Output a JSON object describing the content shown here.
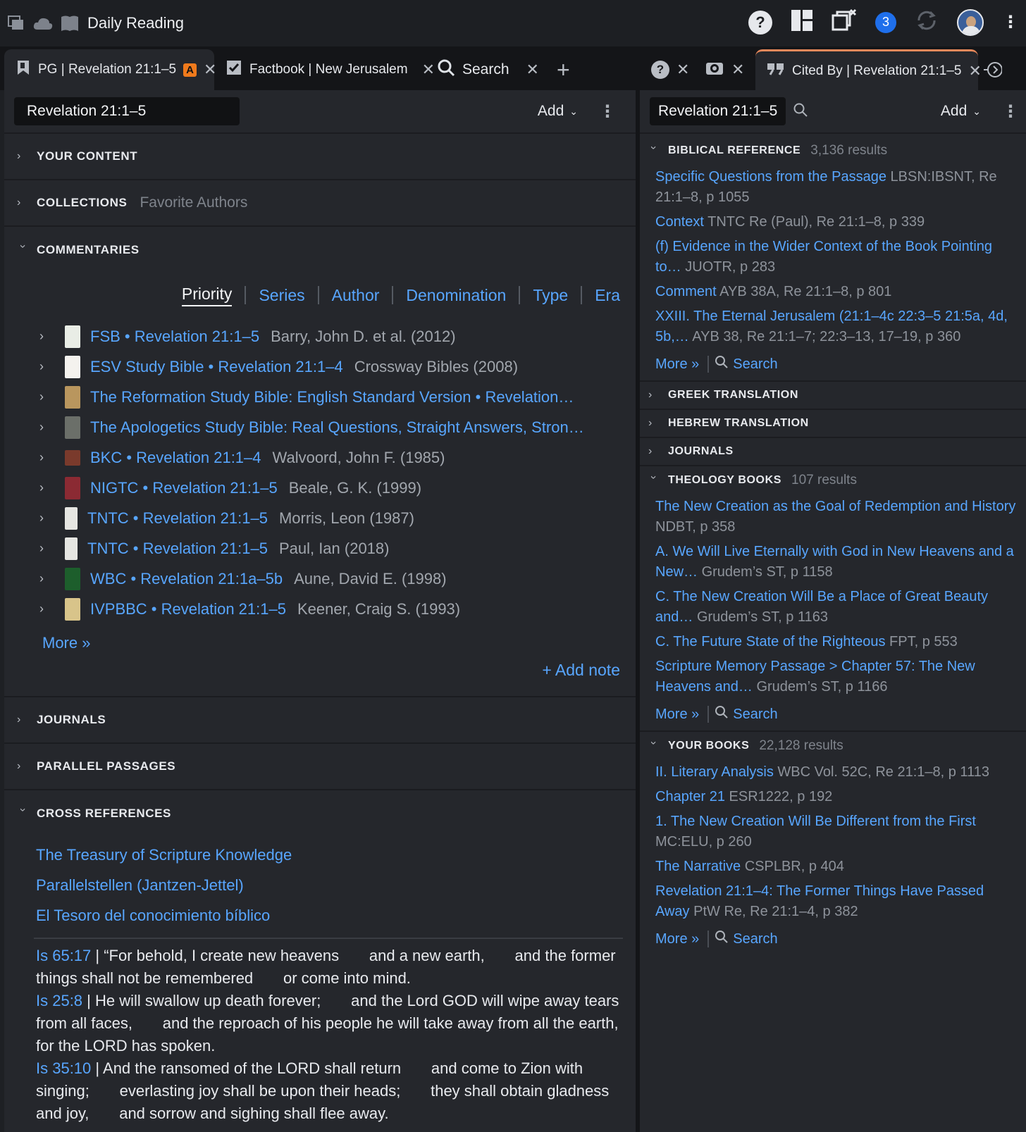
{
  "topbar": {
    "title": "Daily Reading",
    "notification_count": "3"
  },
  "tabs": [
    {
      "label": "PG | Revelation 21:1–5",
      "badge": "A"
    },
    {
      "label": "Factbook | New Jerusalem"
    },
    {
      "label": "Search"
    },
    {
      "label": "Cited By | Revelation 21:1–5"
    }
  ],
  "left": {
    "passage": "Revelation 21:1–5",
    "add_label": "Add",
    "sections": {
      "your_content": "YOUR CONTENT",
      "collections": "COLLECTIONS",
      "collections_sub": "Favorite Authors",
      "commentaries": "COMMENTARIES",
      "journals": "JOURNALS",
      "parallel": "PARALLEL PASSAGES",
      "cross_refs": "CROSS REFERENCES"
    },
    "filters": [
      "Priority",
      "Series",
      "Author",
      "Denomination",
      "Type",
      "Era"
    ],
    "commentaries": [
      {
        "title": "FSB • Revelation 21:1–5",
        "meta": "Barry, John D. et al. (2012)",
        "cover": "#e9ede6"
      },
      {
        "title": "ESV Study Bible • Revelation 21:1–4",
        "meta": "Crossway Bibles (2008)",
        "cover": "#f4f2ee"
      },
      {
        "title": "The Reformation Study Bible: English Standard Version • Revelation…",
        "meta": "",
        "cover": "#b9965e"
      },
      {
        "title": "The Apologetics Study Bible: Real Questions, Straight Answers, Stron…",
        "meta": "",
        "cover": "#6b6f69"
      },
      {
        "title": "BKC • Revelation 21:1–4",
        "meta": "Walvoord, John F. (1985)",
        "cover": "#7a3a2c"
      },
      {
        "title": "NIGTC • Revelation 21:1–5",
        "meta": "Beale, G. K. (1999)",
        "cover": "#8b2a33"
      },
      {
        "title": "TNTC • Revelation 21:1–5",
        "meta": "Morris, Leon (1987)",
        "cover": "#e6e6e2"
      },
      {
        "title": "TNTC • Revelation 21:1–5",
        "meta": "Paul, Ian (2018)",
        "cover": "#e6e6e2"
      },
      {
        "title": "WBC • Revelation 21:1a–5b",
        "meta": "Aune, David E. (1998)",
        "cover": "#1d5e2c"
      },
      {
        "title": "IVPBBC • Revelation 21:1–5",
        "meta": "Keener, Craig S. (1993)",
        "cover": "#d8c48a"
      }
    ],
    "more": "More »",
    "add_note": "+ Add note",
    "cross_ref_sources": [
      "The Treasury of Scripture Knowledge",
      "Parallelstellen (Jantzen-Jettel)",
      "El Tesoro del conocimiento bíblico"
    ],
    "verses": [
      {
        "ref": "Is 65:17",
        "text": "“For behold, I create new heavens       and a new earth,       and the former things shall not be remembered       or come into mind."
      },
      {
        "ref": "Is 25:8",
        "text": "He will swallow up death forever;       and the Lord GOD will wipe away tears from all faces,       and the reproach of his people he will take away from all the earth,       for the LORD has spoken."
      },
      {
        "ref": "Is 35:10",
        "text": "And the ransomed of the LORD shall return       and come to Zion with singing;       everlasting joy shall be upon their heads;       they shall obtain gladness and joy,       and sorrow and sighing shall flee away."
      }
    ]
  },
  "right": {
    "passage": "Revelation 21:1–5",
    "add_label": "Add",
    "biblical_reference": {
      "title": "BIBLICAL REFERENCE",
      "count": "3,136 results",
      "items": [
        {
          "link": "Specific Questions from the Passage",
          "meta": "LBSN:IBSNT, Re 21:1–8, p 1055"
        },
        {
          "link": "Context",
          "meta": "TNTC Re (Paul), Re 21:1–8, p 339"
        },
        {
          "link": "(f) Evidence in the Wider Context of the Book Pointing to…",
          "meta": "JUOTR, p 283"
        },
        {
          "link": "Comment",
          "meta": "AYB 38A, Re 21:1–8, p 801"
        },
        {
          "link": "XXIII. The Eternal Jerusalem (21:1–4c 22:3–5 21:5a, 4d, 5b,…",
          "meta": "AYB 38, Re 21:1–7; 22:3–13, 17–19, p 360"
        }
      ]
    },
    "greek": "GREEK TRANSLATION",
    "hebrew": "HEBREW TRANSLATION",
    "journals": "JOURNALS",
    "theology": {
      "title": "THEOLOGY BOOKS",
      "count": "107 results",
      "items": [
        {
          "link": "The New Creation as the Goal of Redemption and History",
          "meta": "NDBT, p 358"
        },
        {
          "link": "A. We Will Live Eternally with God in New Heavens and a New…",
          "meta": "Grudem’s ST, p 1158"
        },
        {
          "link": "C. The New Creation Will Be a Place of Great Beauty and…",
          "meta": "Grudem’s ST, p 1163"
        },
        {
          "link": "C. The Future State of the Righteous",
          "meta": "FPT, p 553"
        },
        {
          "link": "Scripture Memory Passage > Chapter 57: The New Heavens and…",
          "meta": "Grudem’s ST, p 1166"
        }
      ]
    },
    "your_books": {
      "title": "YOUR BOOKS",
      "count": "22,128 results",
      "items": [
        {
          "link": "II. Literary Analysis",
          "meta": "WBC Vol. 52C, Re 21:1–8, p 1113"
        },
        {
          "link": "Chapter 21",
          "meta": "ESR1222, p 192"
        },
        {
          "link": "1. The New Creation Will Be Different from the First",
          "meta": "MC:ELU, p 260"
        },
        {
          "link": "The Narrative",
          "meta": "CSPLBR, p 404"
        },
        {
          "link": "Revelation 21:1–4: The Former Things Have Passed Away",
          "meta": "PtW Re, Re 21:1–4, p 382"
        }
      ]
    },
    "more": "More »",
    "search": "Search"
  }
}
